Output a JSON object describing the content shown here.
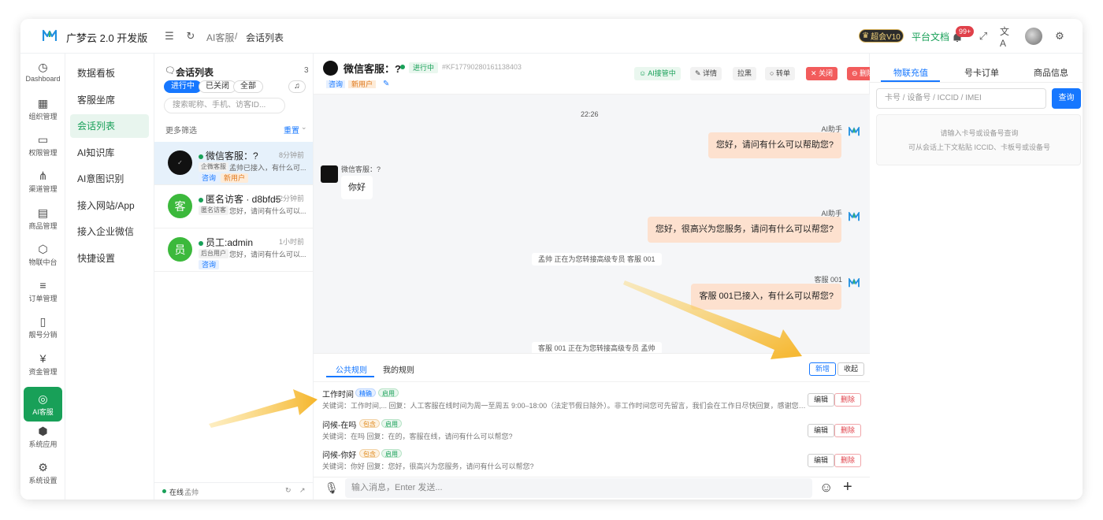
{
  "app": {
    "brand": "广梦云 2.0 开发版"
  },
  "header": {
    "breadcrumb": [
      "AI客服",
      "/",
      "会话列表"
    ],
    "vip_label": "超会V10",
    "docs_label": "平台文档",
    "notification_badge": "99+",
    "accent_color": "#18a058"
  },
  "rail": {
    "items": [
      {
        "label": "Dashboard",
        "icon": "dashboard-icon"
      },
      {
        "label": "组织管理",
        "icon": "grid-icon"
      },
      {
        "label": "权限管理",
        "icon": "monitor-icon"
      },
      {
        "label": "渠道管理",
        "icon": "share-icon"
      },
      {
        "label": "商品管理",
        "icon": "store-icon"
      },
      {
        "label": "物联中台",
        "icon": "cube-icon"
      },
      {
        "label": "订单管理",
        "icon": "list-icon"
      },
      {
        "label": "靓号分销",
        "icon": "phone-icon"
      },
      {
        "label": "资金管理",
        "icon": "wallet-icon"
      },
      {
        "label": "AI客服",
        "icon": "ai-service-icon",
        "active": true
      },
      {
        "label": "系统应用",
        "icon": "box-icon"
      },
      {
        "label": "系统设置",
        "icon": "gear-icon"
      }
    ]
  },
  "submenu": {
    "items": [
      "数据看板",
      "客服坐席",
      "会话列表",
      "AI知识库",
      "AI意图识别",
      "接入网站/App",
      "接入企业微信",
      "快捷设置"
    ],
    "active_index": 2
  },
  "convlist": {
    "title": "会话列表",
    "count": "3",
    "filters": [
      "进行中",
      "已关闭",
      "全部"
    ],
    "search_placeholder": "搜索昵称、手机、访客ID...",
    "more_filters": "更多筛选",
    "reset": "重置",
    "items": [
      {
        "name": "微信客服：?",
        "time": "8分钟前",
        "source": "企微客服",
        "preview": "孟帅已接入，有什么可...",
        "tags": [
          "咨询",
          "新用户"
        ],
        "avatar_text": "",
        "avatar_color": "#111111"
      },
      {
        "name": "匿名访客 · d8bfd5",
        "time": "42分钟前",
        "source": "匿名访客",
        "preview": "您好，请问有什么可以...",
        "tags": [],
        "avatar_text": "客",
        "avatar_color": "#3cb93c"
      },
      {
        "name": "员工:admin",
        "time": "1小时前",
        "source": "后台用户",
        "preview": "您好，请问有什么可以...",
        "tags": [
          "咨询"
        ],
        "avatar_text": "员",
        "avatar_color": "#3cb93c"
      }
    ],
    "status": {
      "online": "在线",
      "user": "孟帅"
    }
  },
  "chat": {
    "title": "微信客服：?",
    "state": "进行中",
    "session_id": "#KF17790280161138403",
    "tags": [
      "咨询",
      "新用户"
    ],
    "actions": {
      "ai_takeover": "AI接管中",
      "detail": "详情",
      "blacklist": "拉黑",
      "transfer": "转单",
      "close": "关闭",
      "delete": "删除"
    },
    "time": "22:26",
    "messages": [
      {
        "who": "AI助手",
        "text": "您好，请问有什么可以帮助您?"
      },
      {
        "who": "微信客服：?",
        "text": "你好"
      },
      {
        "who": "AI助手",
        "text": "您好，很高兴为您服务，请问有什么可以帮您?"
      },
      {
        "system": "孟帅 正在为您转接高级专员 客服 001"
      },
      {
        "who": "客服 001",
        "text": "客服 001已接入，有什么可以帮您?"
      },
      {
        "system": "客服 001 正在为您转接高级专员 孟帅"
      }
    ],
    "input_placeholder": "输入消息，Enter 发送..."
  },
  "rules": {
    "tabs": [
      "公共规则",
      "我的规则"
    ],
    "add": "新增",
    "collapse": "收起",
    "edit": "编辑",
    "delete": "删除",
    "items": [
      {
        "name": "工作时间",
        "match": "精确",
        "status": "启用",
        "keywords": "关键词：工作时间,...",
        "reply": "回复：人工客服在线时间为周一至周五 9:00–18:00（法定节假日除外）。非工作时间您可先留言，我们会在工作日尽快回复，感谢您的理..."
      },
      {
        "name": "问候-在吗",
        "match": "包含",
        "status": "启用",
        "keywords": "关键词：在吗",
        "reply": "回复：在的，客服在线，请问有什么可以帮您?"
      },
      {
        "name": "问候-你好",
        "match": "包含",
        "status": "启用",
        "keywords": "关键词：你好",
        "reply": "回复：您好，很高兴为您服务，请问有什么可以帮您?"
      }
    ]
  },
  "rpanel": {
    "tabs": [
      "物联充值",
      "号卡订单",
      "商品信息"
    ],
    "input_placeholder": "卡号 / 设备号 / ICCID / IMEI",
    "query": "查询",
    "hint1": "请输入卡号或设备号查询",
    "hint2": "可从会话上下文粘贴 ICCID、卡板号或设备号"
  }
}
